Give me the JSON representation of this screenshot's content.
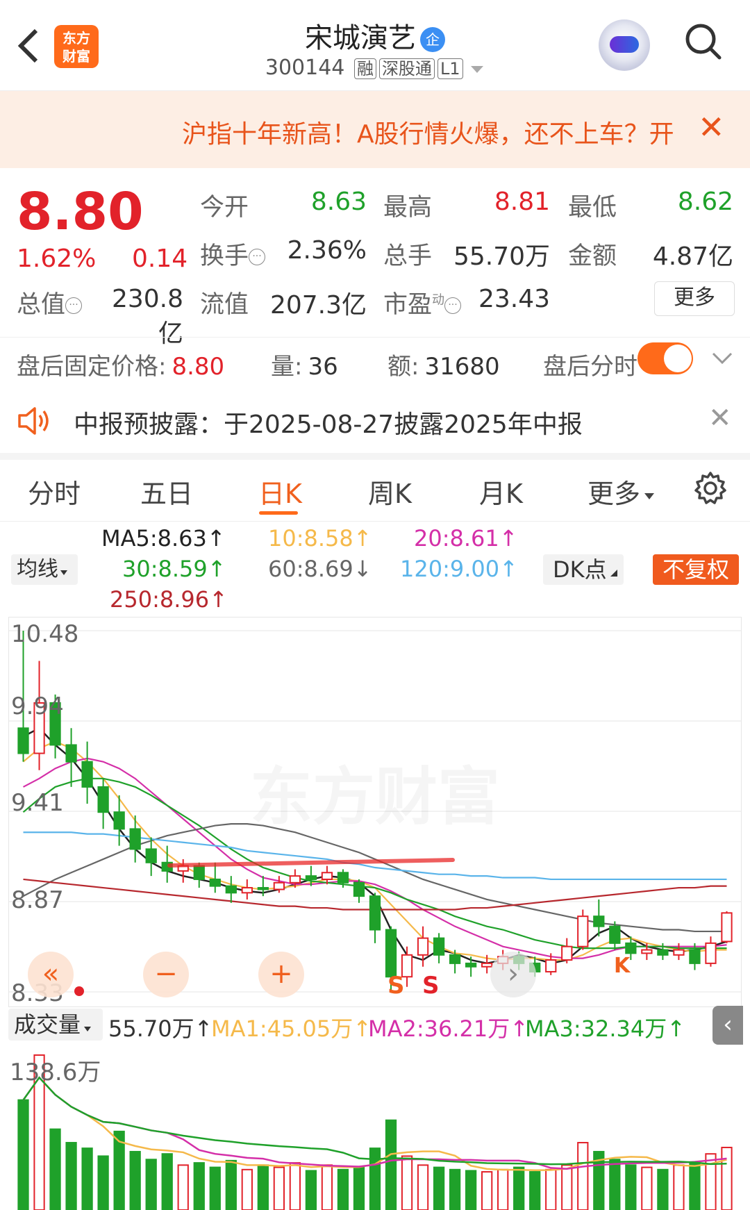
{
  "header": {
    "back_glyph": "<",
    "logo_line1": "东方",
    "logo_line2": "财富",
    "stock_name": "宋城演艺",
    "badge": "企",
    "stock_code": "300144",
    "tags": [
      "融",
      "深股通",
      "L1"
    ]
  },
  "banner": {
    "text": "沪指十年新高！A股行情火爆，还不上车？开",
    "close": "✕"
  },
  "quote": {
    "price": "8.80",
    "change_pct": "1.62%",
    "change_abs": "0.14",
    "rows": [
      [
        {
          "label": "今开",
          "value": "8.63",
          "color": "green"
        },
        {
          "label": "最高",
          "value": "8.81",
          "color": "red"
        },
        {
          "label": "最低",
          "value": "8.62",
          "color": "green"
        }
      ],
      [
        {
          "label": "换手",
          "value": "2.36%",
          "color": "dark"
        },
        {
          "label": "总手",
          "value": "55.70万",
          "color": "dark"
        },
        {
          "label": "金额",
          "value": "4.87亿",
          "color": "dark"
        }
      ],
      [
        {
          "label": "流值",
          "value": "207.3亿",
          "color": "dark"
        },
        {
          "label": "市盈",
          "value": "23.43",
          "color": "dark"
        }
      ]
    ],
    "market_cap_label": "总值",
    "market_cap_value": "230.8亿",
    "pe_sup": "动",
    "more_button": "更多"
  },
  "after_hours": {
    "fixed_price_label": "盘后固定价格:",
    "fixed_price_value": "8.80",
    "vol_label": "量:",
    "vol_value": "36",
    "amt_label": "额:",
    "amt_value": "31680",
    "intraday_label": "盘后分时",
    "toggle_on": true
  },
  "notice": {
    "text": "中报预披露：于2025-08-27披露2025年中报",
    "close": "✕"
  },
  "tabs": {
    "items": [
      "分时",
      "五日",
      "日K",
      "周K",
      "月K",
      "更多"
    ],
    "active": "日K"
  },
  "ma": {
    "avg_button": "均线",
    "dk_button": "DK点",
    "fq_button": "不复权",
    "ma5": "MA5:8.63↑",
    "ma10": "10:8.58↑",
    "ma20": "20:8.61↑",
    "ma30": "30:8.59↑",
    "ma60": "60:8.69↓",
    "ma120": "120:9.00↑",
    "ma250": "250:8.96↑",
    "colors": {
      "ma5": "#222222",
      "ma10": "#f5b94a",
      "ma20": "#d42fa8",
      "ma30": "#1fa12a",
      "ma60": "#666666",
      "ma120": "#5ab4ea",
      "ma250": "#b7282e"
    }
  },
  "kline": {
    "y_labels": [
      "10.48",
      "9.94",
      "9.41",
      "8.87",
      "8.33"
    ],
    "watermark": "东方财富",
    "markers": [
      "S",
      "S",
      "K"
    ]
  },
  "volume": {
    "selector": "成交量",
    "current": "55.70万↑",
    "ma1": "MA1:45.05万↑",
    "ma2": "MA2:36.21万↑",
    "ma3": "MA3:32.34万↑",
    "y_label": "138.6万",
    "colors": {
      "ma1": "#f5b94a",
      "ma2": "#d42fa8",
      "ma3": "#1fa12a"
    }
  },
  "chart_data": {
    "type": "candlestick",
    "ylim": [
      8.33,
      10.48
    ],
    "series": [
      {
        "name": "MA5",
        "values": [
          9.85,
          9.9,
          9.8,
          9.72,
          9.6,
          9.45,
          9.3,
          9.18,
          9.1,
          9.05,
          9.02,
          9.0,
          8.98,
          8.95,
          8.93,
          8.92,
          8.94,
          8.97,
          9.0,
          9.02,
          9.01,
          8.98,
          8.9,
          8.7,
          8.55,
          8.52,
          8.58,
          8.56,
          8.52,
          8.5,
          8.52,
          8.55,
          8.53,
          8.5,
          8.52,
          8.6,
          8.68,
          8.72,
          8.65,
          8.6,
          8.58,
          8.57,
          8.58,
          8.6,
          8.63
        ]
      },
      {
        "name": "MA10",
        "values": [
          9.7,
          9.78,
          9.82,
          9.78,
          9.7,
          9.6,
          9.48,
          9.35,
          9.24,
          9.15,
          9.08,
          9.03,
          9.0,
          8.97,
          8.95,
          8.94,
          8.95,
          8.96,
          8.98,
          9.0,
          9.0,
          8.99,
          8.95,
          8.85,
          8.75,
          8.65,
          8.6,
          8.56,
          8.55,
          8.53,
          8.52,
          8.53,
          8.53,
          8.52,
          8.52,
          8.55,
          8.6,
          8.64,
          8.65,
          8.62,
          8.6,
          8.58,
          8.57,
          8.58,
          8.58
        ]
      },
      {
        "name": "MA20",
        "values": [
          9.55,
          9.6,
          9.66,
          9.7,
          9.72,
          9.7,
          9.66,
          9.6,
          9.52,
          9.44,
          9.36,
          9.28,
          9.2,
          9.12,
          9.06,
          9.01,
          8.99,
          8.97,
          8.97,
          8.98,
          8.99,
          8.99,
          8.97,
          8.93,
          8.88,
          8.82,
          8.77,
          8.72,
          8.68,
          8.64,
          8.6,
          8.58,
          8.56,
          8.54,
          8.53,
          8.53,
          8.55,
          8.58,
          8.6,
          8.6,
          8.6,
          8.6,
          8.6,
          8.6,
          8.61
        ]
      },
      {
        "name": "MA30",
        "values": [
          9.4,
          9.48,
          9.55,
          9.58,
          9.6,
          9.6,
          9.58,
          9.55,
          9.5,
          9.44,
          9.38,
          9.32,
          9.25,
          9.18,
          9.12,
          9.07,
          9.04,
          9.01,
          8.99,
          8.98,
          8.97,
          8.96,
          8.95,
          8.92,
          8.88,
          8.85,
          8.82,
          8.78,
          8.75,
          8.72,
          8.7,
          8.67,
          8.64,
          8.62,
          8.6,
          8.59,
          8.59,
          8.59,
          8.6,
          8.6,
          8.6,
          8.59,
          8.59,
          8.59,
          8.59
        ]
      },
      {
        "name": "MA60",
        "values": [
          8.9,
          8.95,
          9.0,
          9.04,
          9.08,
          9.12,
          9.16,
          9.2,
          9.23,
          9.26,
          9.28,
          9.3,
          9.32,
          9.33,
          9.33,
          9.32,
          9.3,
          9.28,
          9.25,
          9.22,
          9.19,
          9.16,
          9.12,
          9.08,
          9.04,
          9.0,
          8.97,
          8.94,
          8.91,
          8.88,
          8.86,
          8.84,
          8.82,
          8.8,
          8.78,
          8.76,
          8.74,
          8.73,
          8.72,
          8.71,
          8.7,
          8.7,
          8.69,
          8.69,
          8.69
        ]
      },
      {
        "name": "MA120",
        "values": [
          9.28,
          9.28,
          9.28,
          9.28,
          9.27,
          9.27,
          9.26,
          9.25,
          9.24,
          9.23,
          9.22,
          9.21,
          9.2,
          9.19,
          9.17,
          9.16,
          9.15,
          9.14,
          9.13,
          9.12,
          9.1,
          9.09,
          9.07,
          9.06,
          9.05,
          9.04,
          9.03,
          9.03,
          9.02,
          9.02,
          9.01,
          9.01,
          9.01,
          9.0,
          9.0,
          9.0,
          9.0,
          9.0,
          9.0,
          9.0,
          9.0,
          9.0,
          9.0,
          9.0,
          9.0
        ]
      },
      {
        "name": "MA250",
        "values": [
          9.0,
          8.99,
          8.98,
          8.97,
          8.96,
          8.95,
          8.94,
          8.93,
          8.92,
          8.91,
          8.9,
          8.89,
          8.88,
          8.87,
          8.86,
          8.85,
          8.84,
          8.84,
          8.83,
          8.83,
          8.82,
          8.82,
          8.82,
          8.82,
          8.82,
          8.82,
          8.82,
          8.82,
          8.83,
          8.83,
          8.84,
          8.85,
          8.86,
          8.87,
          8.88,
          8.89,
          8.9,
          8.91,
          8.92,
          8.93,
          8.94,
          8.95,
          8.95,
          8.96,
          8.96
        ]
      }
    ],
    "candles": [
      {
        "o": 9.9,
        "c": 9.75,
        "h": 10.48,
        "l": 9.7
      },
      {
        "o": 9.75,
        "c": 10.05,
        "h": 10.3,
        "l": 9.65
      },
      {
        "o": 10.05,
        "c": 9.8,
        "h": 10.1,
        "l": 9.72
      },
      {
        "o": 9.8,
        "c": 9.7,
        "h": 9.9,
        "l": 9.55
      },
      {
        "o": 9.7,
        "c": 9.55,
        "h": 9.82,
        "l": 9.45
      },
      {
        "o": 9.55,
        "c": 9.4,
        "h": 9.6,
        "l": 9.3
      },
      {
        "o": 9.4,
        "c": 9.3,
        "h": 9.5,
        "l": 9.2
      },
      {
        "o": 9.3,
        "c": 9.18,
        "h": 9.38,
        "l": 9.1
      },
      {
        "o": 9.18,
        "c": 9.1,
        "h": 9.25,
        "l": 9.02
      },
      {
        "o": 9.1,
        "c": 9.05,
        "h": 9.2,
        "l": 8.98
      },
      {
        "o": 9.05,
        "c": 9.08,
        "h": 9.12,
        "l": 8.98
      },
      {
        "o": 9.08,
        "c": 9.0,
        "h": 9.1,
        "l": 8.95
      },
      {
        "o": 9.0,
        "c": 8.96,
        "h": 9.1,
        "l": 8.92
      },
      {
        "o": 8.96,
        "c": 8.92,
        "h": 9.02,
        "l": 8.86
      },
      {
        "o": 8.92,
        "c": 8.95,
        "h": 9.0,
        "l": 8.88
      },
      {
        "o": 8.95,
        "c": 8.94,
        "h": 9.02,
        "l": 8.9
      },
      {
        "o": 8.94,
        "c": 8.98,
        "h": 9.02,
        "l": 8.92
      },
      {
        "o": 8.98,
        "c": 9.02,
        "h": 9.06,
        "l": 8.95
      },
      {
        "o": 9.02,
        "c": 9.0,
        "h": 9.08,
        "l": 8.96
      },
      {
        "o": 9.0,
        "c": 9.04,
        "h": 9.08,
        "l": 8.97
      },
      {
        "o": 9.04,
        "c": 8.98,
        "h": 9.06,
        "l": 8.95
      },
      {
        "o": 8.98,
        "c": 8.9,
        "h": 9.0,
        "l": 8.86
      },
      {
        "o": 8.9,
        "c": 8.7,
        "h": 8.92,
        "l": 8.62
      },
      {
        "o": 8.7,
        "c": 8.42,
        "h": 8.72,
        "l": 8.34
      },
      {
        "o": 8.42,
        "c": 8.55,
        "h": 8.6,
        "l": 8.36
      },
      {
        "o": 8.55,
        "c": 8.65,
        "h": 8.72,
        "l": 8.48
      },
      {
        "o": 8.65,
        "c": 8.55,
        "h": 8.68,
        "l": 8.5
      },
      {
        "o": 8.55,
        "c": 8.5,
        "h": 8.58,
        "l": 8.44
      },
      {
        "o": 8.5,
        "c": 8.48,
        "h": 8.54,
        "l": 8.42
      },
      {
        "o": 8.48,
        "c": 8.5,
        "h": 8.55,
        "l": 8.44
      },
      {
        "o": 8.5,
        "c": 8.54,
        "h": 8.58,
        "l": 8.46
      },
      {
        "o": 8.54,
        "c": 8.5,
        "h": 8.57,
        "l": 8.46
      },
      {
        "o": 8.5,
        "c": 8.45,
        "h": 8.54,
        "l": 8.42
      },
      {
        "o": 8.45,
        "c": 8.52,
        "h": 8.56,
        "l": 8.43
      },
      {
        "o": 8.52,
        "c": 8.6,
        "h": 8.65,
        "l": 8.5
      },
      {
        "o": 8.6,
        "c": 8.78,
        "h": 8.82,
        "l": 8.58
      },
      {
        "o": 8.78,
        "c": 8.72,
        "h": 8.88,
        "l": 8.66
      },
      {
        "o": 8.72,
        "c": 8.62,
        "h": 8.75,
        "l": 8.58
      },
      {
        "o": 8.62,
        "c": 8.56,
        "h": 8.66,
        "l": 8.52
      },
      {
        "o": 8.56,
        "c": 8.58,
        "h": 8.62,
        "l": 8.52
      },
      {
        "o": 8.58,
        "c": 8.55,
        "h": 8.62,
        "l": 8.52
      },
      {
        "o": 8.55,
        "c": 8.58,
        "h": 8.62,
        "l": 8.52
      },
      {
        "o": 8.58,
        "c": 8.5,
        "h": 8.62,
        "l": 8.46
      },
      {
        "o": 8.5,
        "c": 8.62,
        "h": 8.66,
        "l": 8.48
      },
      {
        "o": 8.63,
        "c": 8.8,
        "h": 8.81,
        "l": 8.62
      }
    ],
    "volume": [
      98,
      138,
      72,
      60,
      55,
      48,
      70,
      52,
      45,
      50,
      40,
      42,
      38,
      44,
      36,
      40,
      38,
      42,
      35,
      40,
      36,
      38,
      55,
      80,
      48,
      40,
      38,
      36,
      35,
      34,
      36,
      38,
      34,
      36,
      40,
      60,
      52,
      45,
      40,
      38,
      36,
      40,
      42,
      50,
      55.7
    ]
  }
}
